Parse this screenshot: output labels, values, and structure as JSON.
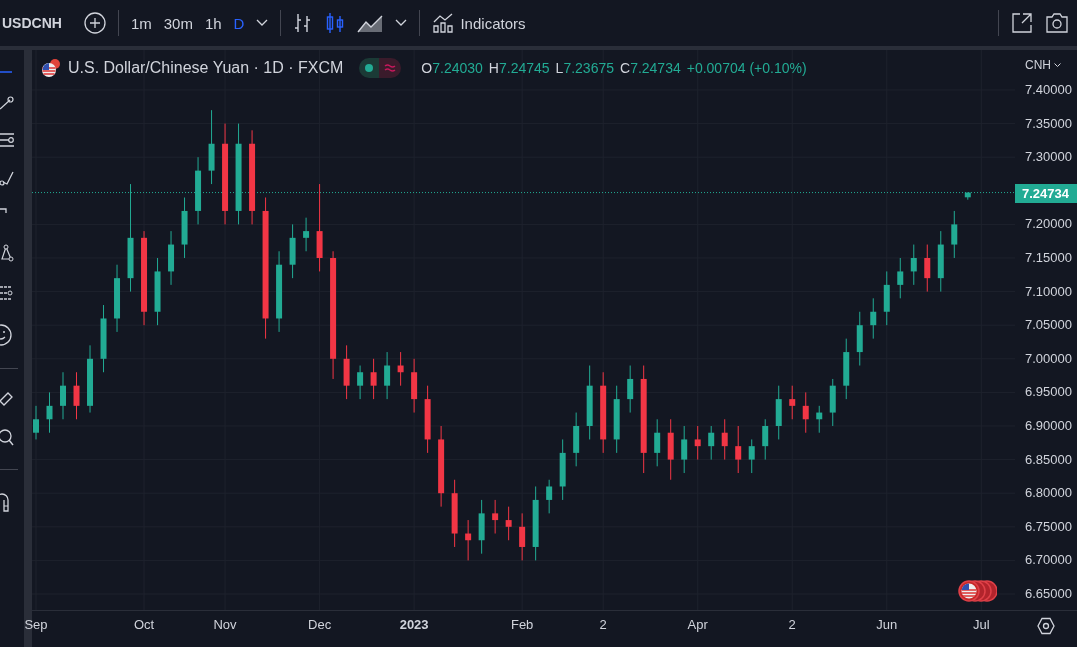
{
  "toolbar": {
    "symbol": "USDCNH",
    "intervals": [
      {
        "label": "1m",
        "selected": false
      },
      {
        "label": "30m",
        "selected": false
      },
      {
        "label": "1h",
        "selected": false
      },
      {
        "label": "D",
        "selected": true
      }
    ],
    "chart_styles": [
      {
        "kind": "bars",
        "selected": false
      },
      {
        "kind": "candles",
        "selected": true
      },
      {
        "kind": "area",
        "selected": false
      }
    ],
    "indicators_label": "Indicators"
  },
  "legend": {
    "values": [
      {
        "key": "O",
        "value": "7.24030"
      },
      {
        "key": "H",
        "value": "7.24745"
      },
      {
        "key": "L",
        "value": "7.23675"
      },
      {
        "key": "C",
        "value": "7.24734"
      }
    ],
    "change": "+0.00704 (+0.10%)"
  },
  "price_axis": {
    "currency": "CNH",
    "last_price": "7.24734"
  },
  "chart_data": {
    "type": "candlestick",
    "title": "U.S. Dollar/Chinese Yuan · 1D · FXCM",
    "ylim": [
      6.6262,
      7.4595
    ],
    "grid": true,
    "ref_lines": [
      {
        "axis": "y",
        "value": 7.24734,
        "color": "#22ab94"
      }
    ],
    "yticks": [
      {
        "value": 7.4,
        "label": "7.40000"
      },
      {
        "value": 7.35,
        "label": "7.35000"
      },
      {
        "value": 7.3,
        "label": "7.30000"
      },
      {
        "value": 7.2,
        "label": "7.20000"
      },
      {
        "value": 7.15,
        "label": "7.15000"
      },
      {
        "value": 7.1,
        "label": "7.10000"
      },
      {
        "value": 7.05,
        "label": "7.05000"
      },
      {
        "value": 7.0,
        "label": "7.00000"
      },
      {
        "value": 6.95,
        "label": "6.95000"
      },
      {
        "value": 6.9,
        "label": "6.90000"
      },
      {
        "value": 6.85,
        "label": "6.85000"
      },
      {
        "value": 6.8,
        "label": "6.80000"
      },
      {
        "value": 6.75,
        "label": "6.75000"
      },
      {
        "value": 6.7,
        "label": "6.70000"
      },
      {
        "value": 6.65,
        "label": "6.65000"
      }
    ],
    "categories": [
      "Sep",
      null,
      null,
      null,
      null,
      null,
      null,
      null,
      "Oct",
      null,
      null,
      null,
      null,
      null,
      "Nov",
      null,
      null,
      null,
      null,
      null,
      null,
      "Dec",
      null,
      null,
      null,
      null,
      null,
      null,
      "2023",
      null,
      null,
      null,
      null,
      null,
      null,
      null,
      "Feb",
      null,
      null,
      null,
      null,
      null,
      "2",
      null,
      null,
      null,
      null,
      null,
      null,
      "Apr",
      null,
      null,
      null,
      null,
      null,
      null,
      "2",
      null,
      null,
      null,
      null,
      null,
      null,
      "Jun",
      null,
      null,
      null,
      null,
      null,
      null,
      "Jul"
    ],
    "ohlc": [
      [
        6.89,
        6.93,
        6.88,
        6.91
      ],
      [
        6.91,
        6.95,
        6.89,
        6.93
      ],
      [
        6.93,
        6.98,
        6.91,
        6.96
      ],
      [
        6.96,
        6.98,
        6.91,
        6.93
      ],
      [
        6.93,
        7.02,
        6.92,
        7.0
      ],
      [
        7.0,
        7.08,
        6.98,
        7.06
      ],
      [
        7.06,
        7.14,
        7.04,
        7.12
      ],
      [
        7.12,
        7.26,
        7.1,
        7.18
      ],
      [
        7.18,
        7.19,
        7.05,
        7.07
      ],
      [
        7.07,
        7.15,
        7.05,
        7.13
      ],
      [
        7.13,
        7.19,
        7.11,
        7.17
      ],
      [
        7.17,
        7.24,
        7.15,
        7.22
      ],
      [
        7.22,
        7.3,
        7.2,
        7.28
      ],
      [
        7.28,
        7.37,
        7.26,
        7.32
      ],
      [
        7.32,
        7.35,
        7.2,
        7.22
      ],
      [
        7.22,
        7.35,
        7.2,
        7.32
      ],
      [
        7.32,
        7.34,
        7.2,
        7.22
      ],
      [
        7.22,
        7.24,
        7.03,
        7.06
      ],
      [
        7.06,
        7.16,
        7.04,
        7.14
      ],
      [
        7.14,
        7.2,
        7.12,
        7.18
      ],
      [
        7.18,
        7.21,
        7.16,
        7.19
      ],
      [
        7.19,
        7.26,
        7.13,
        7.15
      ],
      [
        7.15,
        7.16,
        6.97,
        7.0
      ],
      [
        7.0,
        7.02,
        6.94,
        6.96
      ],
      [
        6.96,
        6.99,
        6.94,
        6.98
      ],
      [
        6.98,
        7.0,
        6.94,
        6.96
      ],
      [
        6.96,
        7.01,
        6.94,
        6.99
      ],
      [
        6.99,
        7.01,
        6.96,
        6.98
      ],
      [
        6.98,
        7.0,
        6.92,
        6.94
      ],
      [
        6.94,
        6.96,
        6.86,
        6.88
      ],
      [
        6.88,
        6.9,
        6.78,
        6.8
      ],
      [
        6.8,
        6.82,
        6.72,
        6.74
      ],
      [
        6.74,
        6.76,
        6.7,
        6.73
      ],
      [
        6.73,
        6.79,
        6.71,
        6.77
      ],
      [
        6.77,
        6.79,
        6.74,
        6.76
      ],
      [
        6.76,
        6.78,
        6.73,
        6.75
      ],
      [
        6.75,
        6.77,
        6.7,
        6.72
      ],
      [
        6.72,
        6.81,
        6.7,
        6.79
      ],
      [
        6.79,
        6.82,
        6.77,
        6.81
      ],
      [
        6.81,
        6.88,
        6.79,
        6.86
      ],
      [
        6.86,
        6.92,
        6.84,
        6.9
      ],
      [
        6.9,
        6.99,
        6.88,
        6.96
      ],
      [
        6.96,
        6.98,
        6.86,
        6.88
      ],
      [
        6.88,
        6.96,
        6.86,
        6.94
      ],
      [
        6.94,
        6.99,
        6.92,
        6.97
      ],
      [
        6.97,
        6.99,
        6.83,
        6.86
      ],
      [
        6.86,
        6.91,
        6.84,
        6.89
      ],
      [
        6.89,
        6.91,
        6.82,
        6.85
      ],
      [
        6.85,
        6.9,
        6.83,
        6.88
      ],
      [
        6.88,
        6.9,
        6.85,
        6.87
      ],
      [
        6.87,
        6.9,
        6.85,
        6.89
      ],
      [
        6.89,
        6.91,
        6.85,
        6.87
      ],
      [
        6.87,
        6.9,
        6.83,
        6.85
      ],
      [
        6.85,
        6.88,
        6.83,
        6.87
      ],
      [
        6.87,
        6.91,
        6.85,
        6.9
      ],
      [
        6.9,
        6.96,
        6.88,
        6.94
      ],
      [
        6.94,
        6.96,
        6.91,
        6.93
      ],
      [
        6.93,
        6.95,
        6.89,
        6.91
      ],
      [
        6.91,
        6.93,
        6.89,
        6.92
      ],
      [
        6.92,
        6.97,
        6.9,
        6.96
      ],
      [
        6.96,
        7.03,
        6.94,
        7.01
      ],
      [
        7.01,
        7.07,
        6.99,
        7.05
      ],
      [
        7.05,
        7.09,
        7.03,
        7.07
      ],
      [
        7.07,
        7.13,
        7.05,
        7.11
      ],
      [
        7.11,
        7.15,
        7.09,
        7.13
      ],
      [
        7.13,
        7.17,
        7.11,
        7.15
      ],
      [
        7.15,
        7.17,
        7.1,
        7.12
      ],
      [
        7.12,
        7.19,
        7.1,
        7.17
      ],
      [
        7.17,
        7.22,
        7.15,
        7.2
      ],
      [
        7.2403,
        7.24745,
        7.23675,
        7.24734
      ],
      null
    ]
  }
}
